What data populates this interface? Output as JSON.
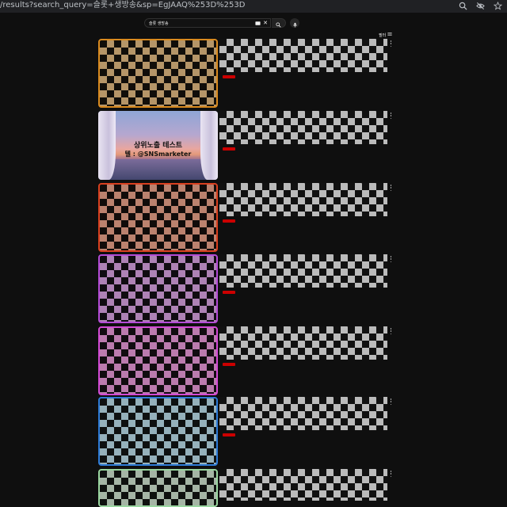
{
  "browser": {
    "url": "/results?search_query=슬롯+생방송&sp=EgJAAQ%253D%253D"
  },
  "search": {
    "query": "슬롯 생방송"
  },
  "filters": {
    "label": "필터"
  },
  "results": [
    {
      "thumb_style": "checker",
      "border": "#d98a1f",
      "tint": "#f0a030"
    },
    {
      "thumb_style": "sunset",
      "thumb_line1": "상위노출 테스트",
      "thumb_line2": "텔 : @SNSmarketer"
    },
    {
      "thumb_style": "checker",
      "border": "#d9401f",
      "tint": "#ff7040"
    },
    {
      "thumb_style": "checker",
      "border": "#b44bd6",
      "tint": "#e070f0"
    },
    {
      "thumb_style": "checker",
      "border": "#d44bd6",
      "tint": "#ff60e0"
    },
    {
      "thumb_style": "checker",
      "border": "#2e7bd6",
      "tint": "#a0e8ff"
    },
    {
      "thumb_style": "checker",
      "border": "#9ad6a0",
      "tint": "#c8f0c8"
    }
  ],
  "icons": {
    "search": "search-icon",
    "clear": "close-icon",
    "keyboard": "keyboard-icon",
    "mic": "mic-icon",
    "filter": "filter-icon",
    "zoom": "zoom-icon",
    "eye_off": "eye-off-icon",
    "star": "star-icon",
    "more": "more-vert-icon"
  }
}
